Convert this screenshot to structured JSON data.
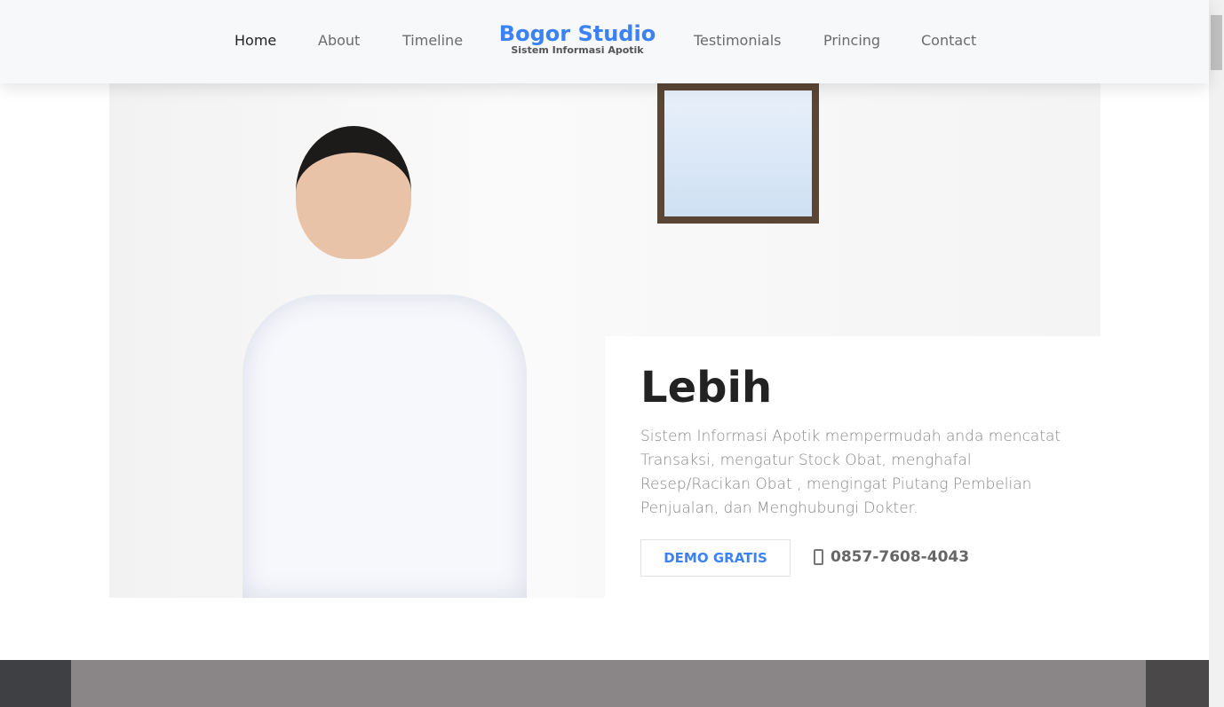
{
  "nav": {
    "items": [
      "Home",
      "About",
      "Timeline",
      "Testimonials",
      "Princing",
      "Contact"
    ],
    "brand_title": "Bogor Studio",
    "brand_subtitle": "Sistem Informasi Apotik"
  },
  "hero": {
    "title": "Lebih",
    "description": "Sistem Informasi Apotik mempermudah anda mencatat Transaksi, mengatur Stock Obat, menghafal Resep/Racikan Obat , mengingat Piutang Pembelian Penjualan, dan Menghubungi Dokter.",
    "button": "DEMO GRATIS",
    "phone": "0857-7608-4043",
    "phone_icon": "mobile-phone-icon"
  },
  "colors": {
    "accent": "#3b82f6"
  }
}
